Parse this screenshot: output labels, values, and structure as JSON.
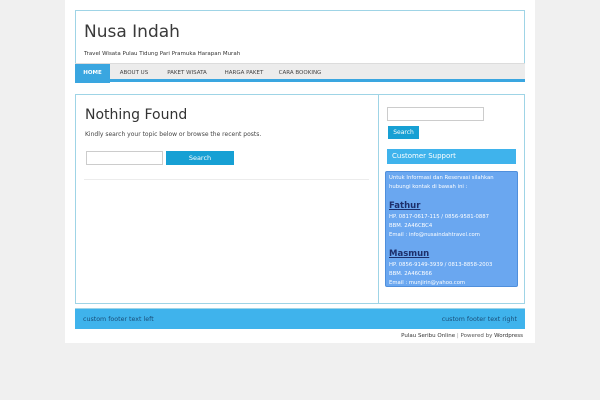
{
  "header": {
    "title": "Nusa Indah",
    "description": "Travel Wisata Pulau Tidung Pari Pramuka Harapan Murah"
  },
  "nav": {
    "items": [
      {
        "label": "HOME"
      },
      {
        "label": "ABOUT US"
      },
      {
        "label": "PAKET WISATA"
      },
      {
        "label": "HARGA PAKET"
      },
      {
        "label": "CARA BOOKING"
      }
    ]
  },
  "content": {
    "title": "Nothing Found",
    "text": "Kindly search your topic below or browse the recent posts.",
    "search_value": "",
    "search_button": "Search"
  },
  "sidebar": {
    "search_value": "",
    "search_button": "Search",
    "widget_title": "Customer Support",
    "intro_1": "Untuk Informasi dan Reservasi silahkan",
    "intro_2": "hubungi kontak di bawah ini :",
    "contacts": [
      {
        "name": "Fathur",
        "phone": "HP. 0817-0617-115 / 0856-9581-0887",
        "bbm": "BBM. 2A46CBC4",
        "email": "Email : info@nusaindahtravel.com"
      },
      {
        "name": "Masmun",
        "phone": "HP. 0856-9149-3939 / 0813-8858-2003",
        "bbm": "BBM. 2A46CB66",
        "email": "Email : munjirin@yahoo.com"
      }
    ]
  },
  "footer": {
    "left": "custom footer text left",
    "right": "custom footer text right"
  },
  "credits": {
    "site": "Pulau Seribu Online",
    "separator": "|",
    "powered_prefix": "Powered by",
    "platform": "Wordpress"
  },
  "colors": {
    "accent": "#3aa6e0",
    "button": "#17a0d4",
    "widget_box": "#6aa7f0",
    "border": "#9fd4e6"
  }
}
